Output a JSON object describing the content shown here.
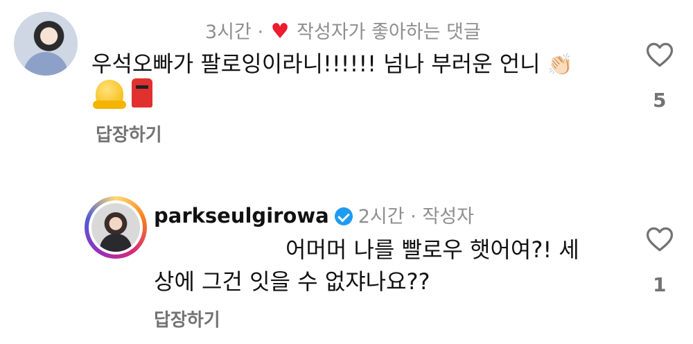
{
  "comment1": {
    "time": "3시간",
    "separator": "·",
    "author_liked_label": "작성자가 좋아하는 댓글",
    "text": "우석오빠가 팔로잉이라니!!!!!! 넘나 부러운 언니",
    "emoji_clap": "👏🏻",
    "reply_label": "답장하기",
    "like_count": "5"
  },
  "comment2": {
    "username": "parkseulgirowa",
    "time": "2시간",
    "separator": "·",
    "author_label": "작성자",
    "text_line1": "어머머 나를 빨로우 햇어여?! 세",
    "text_line2": "상에 그건 잇을 수 없쟈나요??",
    "reply_label": "답장하기",
    "like_count": "1"
  },
  "icons": {
    "heart_filled": "heart-filled-icon",
    "like_outline": "heart-outline-icon",
    "verified": "verified-badge-icon",
    "melting_face": "melting-face-emoji",
    "postbox": "postbox-emoji"
  },
  "colors": {
    "muted_text": "#8e8e8e",
    "reply_text": "#737373",
    "heart_red": "#ed1c30",
    "verified_blue": "#1d9bf0"
  }
}
